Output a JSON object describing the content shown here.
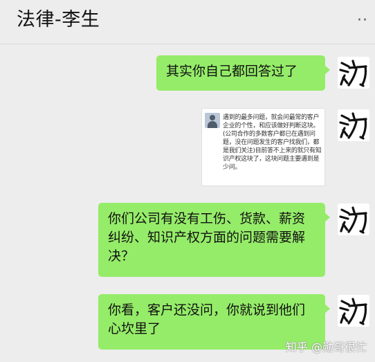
{
  "header": {
    "title": "法律-李生",
    "more_icon": "more-dots-icon",
    "more_glyph": "··"
  },
  "messages": [
    {
      "type": "text",
      "text": "其实你自己都回答过了"
    },
    {
      "type": "image",
      "content": "遇到的最多问题，就会问最常的客户企业的个性，和应该做好判断这块。(公司合作的多数客户都已在遇到问题，没在问题发生的客户找我们，都是我们关注)目前答不上来的就只有知识产权这块了，这块问题主要遇到是少问。"
    },
    {
      "type": "text",
      "text": "你们公司有没有工伤、货款、薪资纠纷、知识产权方面的问题需要解决？"
    },
    {
      "type": "text",
      "text": "你看，客户还没问，你就说到他们心坎里了"
    }
  ],
  "watermark": "知乎 @勋哥很忙",
  "colors": {
    "background": "#ededed",
    "bubble": "#95ec69",
    "text": "#111111"
  }
}
